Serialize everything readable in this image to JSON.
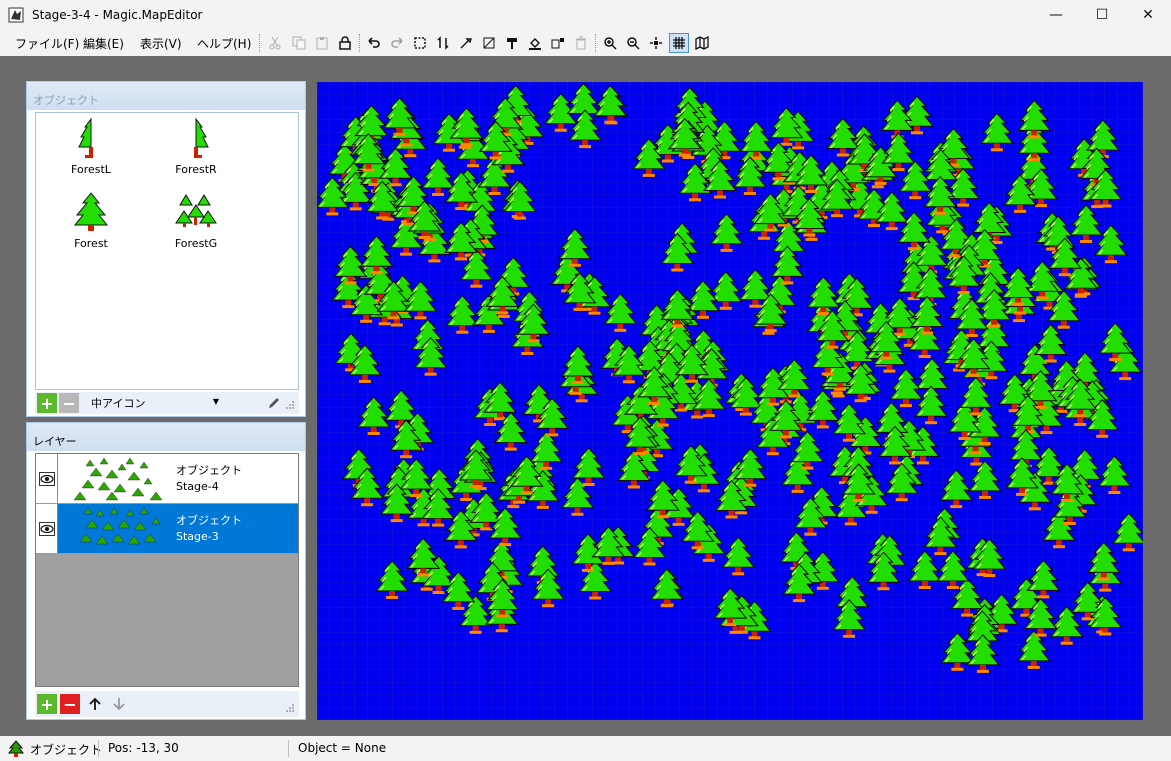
{
  "window": {
    "title": "Stage-3-4  - Magic.MapEditor",
    "controls": {
      "minimize": "—",
      "maximize": "☐",
      "close": "✕"
    }
  },
  "menu": {
    "items": [
      "ファイル(F)",
      "編集(E)",
      "表示(V)",
      "ヘルプ(H)"
    ]
  },
  "toolbar": {
    "buttons": [
      {
        "icon": "cut-icon",
        "enabled": false
      },
      {
        "icon": "copy-icon",
        "enabled": false
      },
      {
        "icon": "paste-icon",
        "enabled": false
      },
      {
        "icon": "lock-icon",
        "enabled": true
      },
      {
        "icon": "undo-icon",
        "enabled": true
      },
      {
        "icon": "redo-icon",
        "enabled": false
      },
      {
        "icon": "select-icon",
        "enabled": true
      },
      {
        "icon": "swap-icon",
        "enabled": true
      },
      {
        "icon": "eyedropper-icon",
        "enabled": true
      },
      {
        "icon": "eraser-icon",
        "enabled": true
      },
      {
        "icon": "stamp-icon",
        "enabled": true
      },
      {
        "icon": "fill-icon",
        "enabled": true
      },
      {
        "icon": "replace-icon",
        "enabled": true
      },
      {
        "icon": "delete-icon",
        "enabled": false
      },
      {
        "icon": "zoom-in-icon",
        "enabled": true
      },
      {
        "icon": "zoom-out-icon",
        "enabled": true
      },
      {
        "icon": "fit-icon",
        "enabled": true
      },
      {
        "icon": "grid-icon",
        "enabled": true,
        "active": true
      },
      {
        "icon": "map-icon",
        "enabled": true
      }
    ]
  },
  "object_panel": {
    "header": "オブジェクト",
    "items": [
      {
        "label": "ForestL",
        "icon": "forest-left-icon"
      },
      {
        "label": "ForestR",
        "icon": "forest-right-icon"
      },
      {
        "label": "Forest",
        "icon": "forest-icon"
      },
      {
        "label": "ForestG",
        "icon": "forest-group-icon"
      }
    ],
    "icon_size": "中アイコン"
  },
  "layer_panel": {
    "header": "レイヤー",
    "layers": [
      {
        "type": "オブジェクト",
        "name": "Stage-4",
        "selected": false,
        "visible": true
      },
      {
        "type": "オブジェクト",
        "name": "Stage-3",
        "selected": true,
        "visible": true
      }
    ]
  },
  "map": {
    "background_color": "#0000ee",
    "grid": true
  },
  "status": {
    "mode": "オブジェクト",
    "position": "Pos: -13, 30",
    "object": "Object = None"
  },
  "colors": {
    "selection": "#0078d7",
    "tree_green": "#22dd00",
    "trunk_red": "#cc2200",
    "add_green": "#5cb82c",
    "remove_red": "#e02020"
  }
}
